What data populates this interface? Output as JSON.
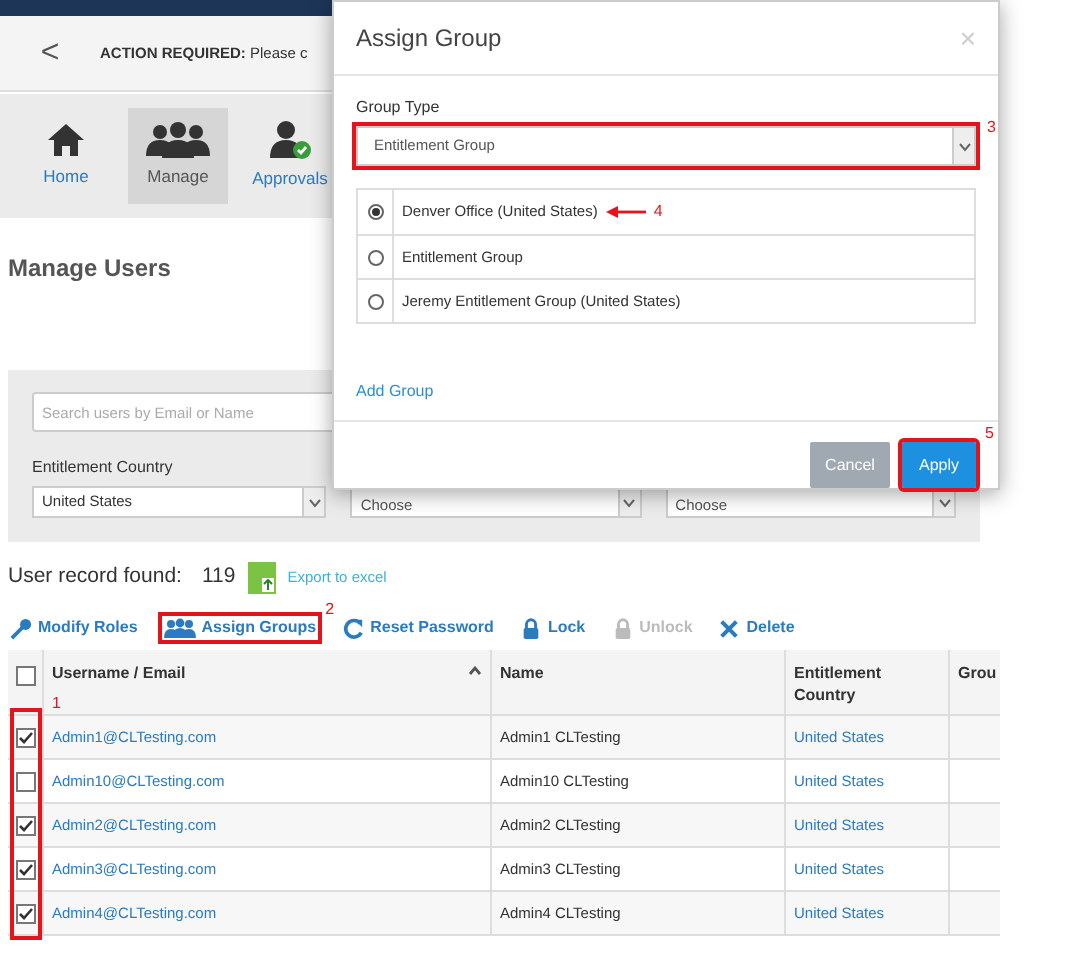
{
  "header": {
    "back": "<",
    "notice_bold": "ACTION REQUIRED:",
    "notice": "Please c"
  },
  "nav": [
    {
      "label": "Home",
      "kind": "home",
      "selected": false
    },
    {
      "label": "Manage",
      "kind": "users",
      "selected": true
    },
    {
      "label": "Approvals",
      "kind": "approve",
      "selected": false
    }
  ],
  "page_title": "Manage Users",
  "filters": {
    "search": {
      "placeholder": "Search users by Email or Name"
    },
    "country": {
      "label": "Entitlement Country",
      "value": "United States"
    },
    "selects": [
      {
        "value": "Choose"
      },
      {
        "value": "Choose"
      }
    ]
  },
  "record_count": {
    "label": "User record found:",
    "value": "119",
    "export": "Export to excel"
  },
  "toolbar": [
    {
      "label": "Modify Roles",
      "kind": "key",
      "disabled": false,
      "highlighted": false
    },
    {
      "label": "Assign Groups",
      "kind": "users",
      "disabled": false,
      "highlighted": true,
      "callout": "2"
    },
    {
      "label": "Reset Password",
      "kind": "reset",
      "disabled": false,
      "highlighted": false
    },
    {
      "label": "Lock",
      "kind": "lock",
      "disabled": false,
      "highlighted": false
    },
    {
      "label": "Unlock",
      "kind": "lock",
      "disabled": true,
      "highlighted": false
    },
    {
      "label": "Delete",
      "kind": "x",
      "disabled": false,
      "highlighted": false
    }
  ],
  "table": {
    "select_all": {
      "checked": false
    },
    "checkbox_column": {
      "highlighted": true,
      "callout": "1"
    },
    "columns": [
      "Username / Email",
      "Name",
      "Entitlement Country",
      "Grou"
    ],
    "rows": [
      {
        "checked": true,
        "email": "Admin1@CLTesting.com",
        "name": "Admin1 CLTesting",
        "country": "United States"
      },
      {
        "checked": false,
        "email": "Admin10@CLTesting.com",
        "name": "Admin10 CLTesting",
        "country": "United States"
      },
      {
        "checked": true,
        "email": "Admin2@CLTesting.com",
        "name": "Admin2 CLTesting",
        "country": "United States"
      },
      {
        "checked": true,
        "email": "Admin3@CLTesting.com",
        "name": "Admin3 CLTesting",
        "country": "United States"
      },
      {
        "checked": true,
        "email": "Admin4@CLTesting.com",
        "name": "Admin4 CLTesting",
        "country": "United States"
      }
    ]
  },
  "modal": {
    "title": "Assign Group",
    "close": "×",
    "group_type": {
      "label": "Group Type",
      "value": "Entitlement Group",
      "highlighted": true,
      "callout": "3"
    },
    "options": [
      {
        "label": "Denver Office (United States)",
        "selected": true,
        "callout": "4"
      },
      {
        "label": "Entitlement Group",
        "selected": false
      },
      {
        "label": "Jeremy Entitlement Group (United States)",
        "selected": false
      }
    ],
    "add_link": "Add Group",
    "buttons": [
      {
        "label": "Cancel",
        "kind": "secondary",
        "highlighted": false
      },
      {
        "label": "Apply",
        "kind": "primary",
        "highlighted": true,
        "callout": "5"
      }
    ]
  }
}
